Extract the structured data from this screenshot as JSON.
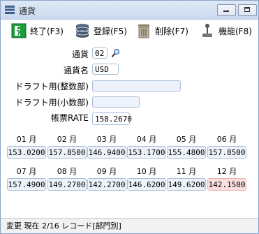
{
  "window": {
    "title": "通貨"
  },
  "toolbar": {
    "exit": "終了(F3)",
    "register": "登録(F5)",
    "delete": "削除(F7)",
    "function": "機能(F8)"
  },
  "form": {
    "currency_label": "通貨",
    "currency_value": "02",
    "currency_name_label": "通貨名",
    "currency_name_value": "USD",
    "draft_integer_label": "ドラフト用(整数部)",
    "draft_integer_value": "",
    "draft_decimal_label": "ドラフト用(小数部)",
    "draft_decimal_value": "",
    "rate_label": "帳票RATE",
    "rate_value": "158.2670"
  },
  "months_row1": [
    {
      "label": "01 月",
      "value": "153.0200"
    },
    {
      "label": "02 月",
      "value": "157.8500"
    },
    {
      "label": "03 月",
      "value": "146.9400"
    },
    {
      "label": "04 月",
      "value": "153.1700"
    },
    {
      "label": "05 月",
      "value": "155.4800"
    },
    {
      "label": "06 月",
      "value": "157.8500"
    }
  ],
  "months_row2": [
    {
      "label": "07 月",
      "value": "157.4900"
    },
    {
      "label": "08 月",
      "value": "149.2700"
    },
    {
      "label": "09 月",
      "value": "142.2700"
    },
    {
      "label": "10 月",
      "value": "146.6200"
    },
    {
      "label": "11 月",
      "value": "149.6200"
    },
    {
      "label": "12 月",
      "value": "142.1500"
    }
  ],
  "status": {
    "text": "変更 現在 2/16 レコード[部門別]"
  }
}
